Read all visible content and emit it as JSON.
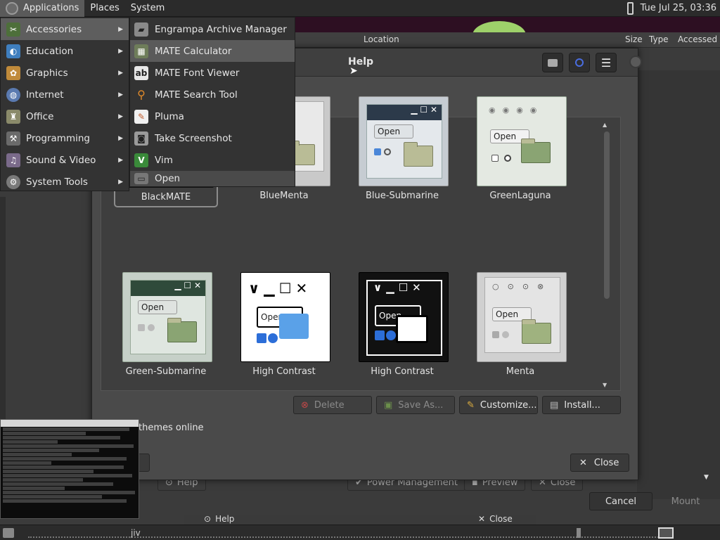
{
  "top_panel": {
    "applications": "Applications",
    "places": "Places",
    "system": "System",
    "clock": "Tue Jul 25, 03:36"
  },
  "file_manager": {
    "columns": [
      "Location",
      "Size",
      "Type",
      "Accessed"
    ],
    "cancel": "Cancel",
    "mount": "Mount"
  },
  "background_buttons": {
    "help": "Help",
    "power_management": "Power Management",
    "preview": "Preview",
    "close": "Close",
    "help_lower": "Help",
    "close_lower": "Close"
  },
  "dialog": {
    "title": "Help",
    "themes": [
      {
        "name": "BlackMATE",
        "selected": true
      },
      {
        "name": "BlueMenta",
        "selected": false
      },
      {
        "name": "Blue-Submarine",
        "selected": false
      },
      {
        "name": "GreenLaguna",
        "selected": false
      },
      {
        "name": "Green-Submarine",
        "selected": false
      },
      {
        "name": "High Contrast",
        "selected": false
      },
      {
        "name": "High Contrast",
        "selected": false
      },
      {
        "name": "Menta",
        "selected": false
      }
    ],
    "thumb_open": "Open",
    "delete": "Delete",
    "save_as": "Save As...",
    "customize": "Customize...",
    "install": "Install...",
    "themes_online": "themes online",
    "close": "Close"
  },
  "app_menu": {
    "items": [
      {
        "label": "Accessories",
        "icon": "accessories-icon"
      },
      {
        "label": "Education",
        "icon": "education-icon"
      },
      {
        "label": "Graphics",
        "icon": "graphics-icon"
      },
      {
        "label": "Internet",
        "icon": "internet-icon"
      },
      {
        "label": "Office",
        "icon": "office-icon"
      },
      {
        "label": "Programming",
        "icon": "programming-icon"
      },
      {
        "label": "Sound & Video",
        "icon": "sound-video-icon"
      },
      {
        "label": "System Tools",
        "icon": "system-tools-icon"
      }
    ]
  },
  "accessories_menu": {
    "items": [
      {
        "label": "Engrampa Archive Manager",
        "icon": "archive-icon"
      },
      {
        "label": "MATE Calculator",
        "icon": "calculator-icon"
      },
      {
        "label": "MATE Font Viewer",
        "icon": "font-viewer-icon"
      },
      {
        "label": "MATE Search Tool",
        "icon": "search-tool-icon"
      },
      {
        "label": "Pluma",
        "icon": "text-editor-icon"
      },
      {
        "label": "Take Screenshot",
        "icon": "screenshot-icon"
      },
      {
        "label": "Vim",
        "icon": "vim-icon"
      },
      {
        "label": "Open",
        "icon": "open-folder-icon"
      }
    ]
  },
  "taskbar": {
    "item": "jiv"
  },
  "colors": {
    "panel_bg": "#2b2b2b",
    "menu_highlight": "#5e5e5e",
    "desktop_accent": "#9ed16a"
  }
}
